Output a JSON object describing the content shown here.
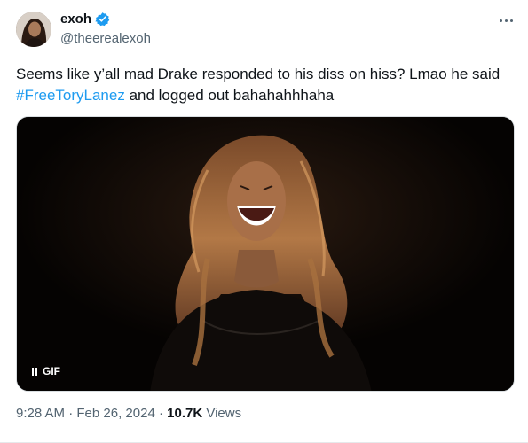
{
  "author": {
    "display_name": "exoh",
    "handle": "@theerealexoh"
  },
  "tweet": {
    "text_before": "Seems like y’all mad Drake responded to his diss on hiss? Lmao he said ",
    "hashtag": "#FreeToryLanez",
    "text_after": " and logged out bahahahhhaha"
  },
  "media": {
    "type_label": "GIF"
  },
  "meta": {
    "time": "9:28 AM",
    "separator": " · ",
    "date": "Feb 26, 2024",
    "views_count": "10.7K",
    "views_label": " Views"
  },
  "icons": {
    "verified": "verified-badge-icon",
    "more": "more-horizontal-icon",
    "pause": "pause-icon"
  },
  "colors": {
    "link": "#1d9bf0",
    "secondary_text": "#536471",
    "primary_text": "#0f1419"
  }
}
